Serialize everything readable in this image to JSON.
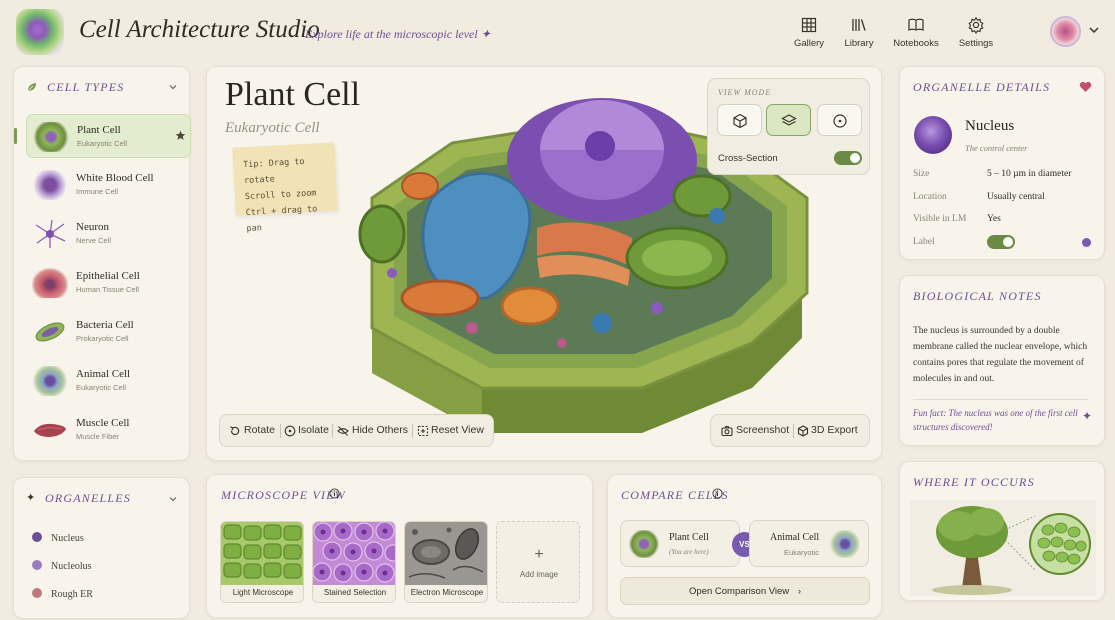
{
  "header": {
    "app_title": "Cell Architecture Studio",
    "tagline": "Explore life at the microscopic level ✦",
    "nav": [
      {
        "label": "Gallery",
        "icon": "gallery-icon"
      },
      {
        "label": "Library",
        "icon": "library-icon"
      },
      {
        "label": "Notebooks",
        "icon": "notebook-icon"
      },
      {
        "label": "Settings",
        "icon": "gear-icon"
      }
    ]
  },
  "cell_types": {
    "title": "CELL TYPES",
    "items": [
      {
        "name": "Plant Cell",
        "sub": "Eukaryotic Cell",
        "active": true
      },
      {
        "name": "White Blood Cell",
        "sub": "Immune Cell"
      },
      {
        "name": "Neuron",
        "sub": "Nerve Cell"
      },
      {
        "name": "Epithelial Cell",
        "sub": "Human Tissue Cell"
      },
      {
        "name": "Bacteria Cell",
        "sub": "Prokaryotic Cell"
      },
      {
        "name": "Animal Cell",
        "sub": "Eukaryotic Cell"
      },
      {
        "name": "Muscle Cell",
        "sub": "Muscle Fiber"
      }
    ]
  },
  "organelles": {
    "title": "ORGANELLES",
    "items": [
      {
        "name": "Nucleus",
        "color": "#6a4f98"
      },
      {
        "name": "Nucleolus",
        "color": "#9a7cc0"
      },
      {
        "name": "Rough ER",
        "color": "#c0787a"
      }
    ]
  },
  "viewer": {
    "cell_name": "Plant Cell",
    "cell_sub": "Eukaryotic Cell",
    "tip_lines": [
      "Tip: Drag to rotate",
      "Scroll to zoom",
      "Ctrl + drag to pan"
    ],
    "view_mode_title": "VIEW MODE",
    "cross_section_label": "Cross-Section",
    "cross_section_on": true,
    "tools": [
      "Rotate",
      "Isolate",
      "Hide Others",
      "Reset View"
    ],
    "actions": [
      "Screenshot",
      "3D Export"
    ]
  },
  "organelle_details": {
    "title": "ORGANELLE DETAILS",
    "name": "Nucleus",
    "sub": "The control center",
    "rows": [
      {
        "key": "Size",
        "value": "5 – 10 µm in diameter"
      },
      {
        "key": "Location",
        "value": "Usually central"
      },
      {
        "key": "Visible in LM",
        "value": "Yes"
      }
    ],
    "label_key": "Label",
    "label_on": true
  },
  "notes": {
    "title": "BIOLOGICAL NOTES",
    "text": "The nucleus is surrounded by a double membrane called the nuclear envelope, which contains pores that regulate the movement of molecules in and out.",
    "fun_fact": "Fun fact: The nucleus was one of the first cell structures discovered!"
  },
  "where": {
    "title": "WHERE IT OCCURS"
  },
  "microscope": {
    "title": "MICROSCOPE VIEW",
    "cards": [
      "Light Microscope",
      "Stained Selection",
      "Electron Microscope"
    ],
    "add_label": "Add image"
  },
  "compare": {
    "title": "COMPARE CELLS",
    "left_name": "Plant Cell",
    "left_sub": "(You are here)",
    "vs": "VS",
    "right_name": "Animal Cell",
    "right_sub": "Eukaryotic",
    "button": "Open Comparison View"
  }
}
